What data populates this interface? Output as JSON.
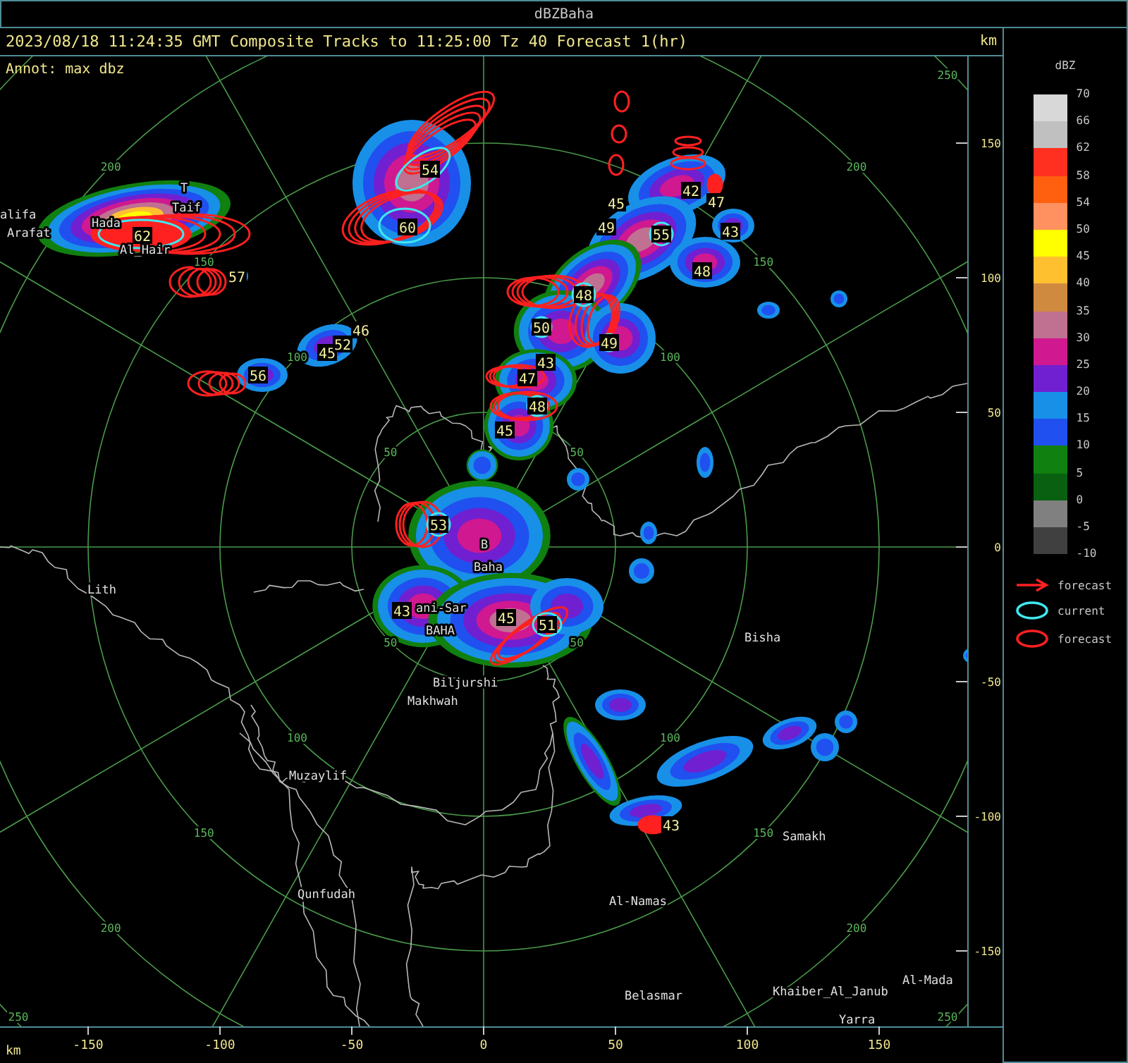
{
  "window": {
    "title": "dBZBaha"
  },
  "header": {
    "text": "2023/08/18 11:24:35 GMT Composite Tracks to 11:25:00 Tz 40 Forecast 1(hr)",
    "unit": "km"
  },
  "annotation": "Annot: max dbz",
  "map": {
    "range_labels": [
      "250",
      "200",
      "200",
      "150",
      "150",
      "100",
      "100",
      "50",
      "50",
      "50",
      "50",
      "100",
      "100",
      "150",
      "150",
      "200",
      "200",
      "250",
      "250"
    ],
    "places": [
      {
        "name": "alifa"
      },
      {
        "name": "Arafat"
      },
      {
        "name": "Hada"
      },
      {
        "name": "Al_Hair"
      },
      {
        "name": "T"
      },
      {
        "name": "Taif"
      },
      {
        "name": "Lith"
      },
      {
        "name": "ani-Sar"
      },
      {
        "name": "B"
      },
      {
        "name": "Baha"
      },
      {
        "name": "BAHA"
      },
      {
        "name": "Biljurshi"
      },
      {
        "name": "Makhwah"
      },
      {
        "name": "Muzaylif"
      },
      {
        "name": "Qunfudah"
      },
      {
        "name": "Bisha"
      },
      {
        "name": "Samakh"
      },
      {
        "name": "Al-Namas"
      },
      {
        "name": "Belasmar"
      },
      {
        "name": "Khaiber_Al_Janub"
      },
      {
        "name": "Al-Mada"
      },
      {
        "name": "Yarra"
      }
    ],
    "cells": [
      {
        "label": "62"
      },
      {
        "label": "57"
      },
      {
        "label": "56"
      },
      {
        "label": "45"
      },
      {
        "label": "52"
      },
      {
        "label": "46"
      },
      {
        "label": "54"
      },
      {
        "label": "60"
      },
      {
        "label": "45"
      },
      {
        "label": "42"
      },
      {
        "label": "47"
      },
      {
        "label": "49"
      },
      {
        "label": "55"
      },
      {
        "label": "43"
      },
      {
        "label": "48"
      },
      {
        "label": "48"
      },
      {
        "label": "50"
      },
      {
        "label": "49"
      },
      {
        "label": "43"
      },
      {
        "label": "47"
      },
      {
        "label": "48"
      },
      {
        "label": "45"
      },
      {
        "label": "53"
      },
      {
        "label": "43"
      },
      {
        "label": "45"
      },
      {
        "label": "51"
      },
      {
        "label": "43"
      }
    ]
  },
  "y_axis": {
    "ticks": [
      "150",
      "100",
      "50",
      "0",
      "-50",
      "-100",
      "-150"
    ]
  },
  "x_axis": {
    "unit": "km",
    "ticks": [
      "-150",
      "-100",
      "-50",
      "0",
      "50",
      "100",
      "150"
    ]
  },
  "legend": {
    "title": "dBZ",
    "scale_labels": [
      "70",
      "66",
      "62",
      "58",
      "54",
      "50",
      "45",
      "40",
      "35",
      "30",
      "25",
      "20",
      "15",
      "10",
      "5",
      "0",
      "-5",
      "-10"
    ],
    "bins": [
      {
        "color": "#d8d8d8"
      },
      {
        "color": "#c0c0c0"
      },
      {
        "color": "#ff3020"
      },
      {
        "color": "#ff6010"
      },
      {
        "color": "#ff9060"
      },
      {
        "color": "#ffff00"
      },
      {
        "color": "#ffc030"
      },
      {
        "color": "#d08a40"
      },
      {
        "color": "#c07090"
      },
      {
        "color": "#d01890"
      },
      {
        "color": "#7020d0"
      },
      {
        "color": "#1890e8"
      },
      {
        "color": "#2050f0"
      },
      {
        "color": "#108010"
      },
      {
        "color": "#086010"
      },
      {
        "color": "#808080"
      },
      {
        "color": "#404040"
      }
    ],
    "keys": [
      {
        "kind": "arrow",
        "label": "forecast"
      },
      {
        "kind": "current",
        "label": "current"
      },
      {
        "kind": "forecast",
        "label": "forecast"
      }
    ]
  }
}
